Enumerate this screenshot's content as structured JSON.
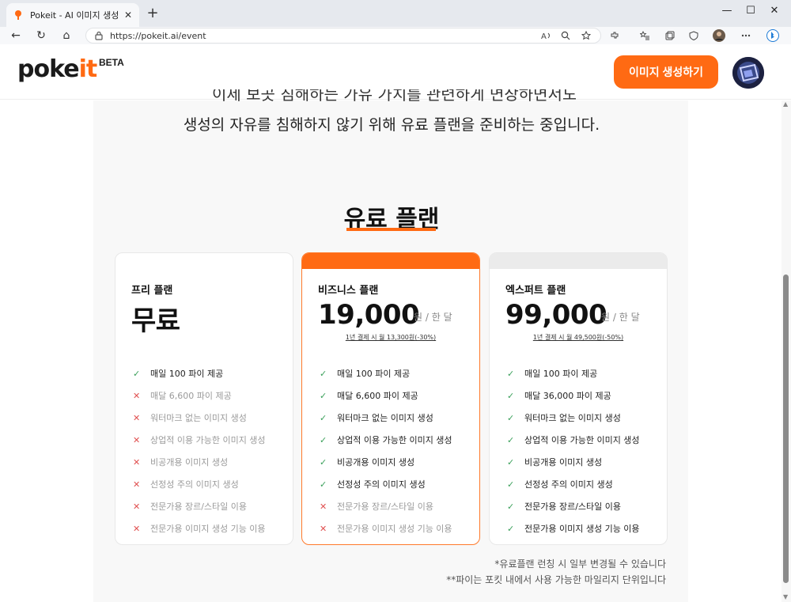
{
  "browser": {
    "tab_title": "Pokeit - AI 이미지 생성 레시피 공",
    "tab_close": "✕",
    "new_tab": "+",
    "url": "https://pokeit.ai/event",
    "window_controls": {
      "minimize": "—",
      "maximize": "☐",
      "close": "✕"
    },
    "nav": {
      "back": "←",
      "reload": "↻",
      "home": "⌂"
    }
  },
  "header": {
    "logo_main": "poke",
    "logo_accent": "it",
    "beta_label": "BETA",
    "cta_label": "이미지 생성하기"
  },
  "intro": {
    "line_cut": "이제 보곳 침해하는 가유 가치를 관련하게 면장하면서도",
    "line2": "생성의 자유를 침해하지 않기 위해 유료 플랜을 준비하는 중입니다."
  },
  "plans_title": "유료 플랜",
  "plans": [
    {
      "name": "프리 플랜",
      "price": "무료",
      "unit": "",
      "note": "",
      "features": [
        {
          "label": "매일 100 파이 제공",
          "included": true
        },
        {
          "label": "매달 6,600 파이 제공",
          "included": false
        },
        {
          "label": "워터마크 없는 이미지 생성",
          "included": false
        },
        {
          "label": "상업적 이용 가능한 이미지 생성",
          "included": false
        },
        {
          "label": "비공개용 이미지 생성",
          "included": false
        },
        {
          "label": "선정성 주의 이미지 생성",
          "included": false
        },
        {
          "label": "전문가용 장르/스타일 이용",
          "included": false
        },
        {
          "label": "전문가용 이미지 생성 기능 이용",
          "included": false
        }
      ]
    },
    {
      "name": "비즈니스 플랜",
      "price": "19,000",
      "unit": "원 / 한 달",
      "note": "1년 결제 시 월 13,300원(-30%)",
      "features": [
        {
          "label": "매일 100 파이 제공",
          "included": true
        },
        {
          "label": "매달 6,600 파이 제공",
          "included": true
        },
        {
          "label": "워터마크 없는 이미지 생성",
          "included": true
        },
        {
          "label": "상업적 이용 가능한 이미지 생성",
          "included": true
        },
        {
          "label": "비공개용 이미지 생성",
          "included": true
        },
        {
          "label": "선정성 주의 이미지 생성",
          "included": true
        },
        {
          "label": "전문가용 장르/스타일 이용",
          "included": false
        },
        {
          "label": "전문가용 이미지 생성 기능 이용",
          "included": false
        }
      ]
    },
    {
      "name": "엑스퍼트 플랜",
      "price": "99,000",
      "unit": "원 / 한 달",
      "note": "1년 결제 시 월 49,500원(-50%)",
      "features": [
        {
          "label": "매일 100 파이 제공",
          "included": true
        },
        {
          "label": "매달 36,000 파이 제공",
          "included": true
        },
        {
          "label": "워터마크 없는 이미지 생성",
          "included": true
        },
        {
          "label": "상업적 이용 가능한 이미지 생성",
          "included": true
        },
        {
          "label": "비공개용 이미지 생성",
          "included": true
        },
        {
          "label": "선정성 주의 이미지 생성",
          "included": true
        },
        {
          "label": "전문가용 장르/스타일 이용",
          "included": true
        },
        {
          "label": "전문가용 이미지 생성 기능 이용",
          "included": true
        }
      ]
    }
  ],
  "footnotes": [
    "*유료플랜 런칭 시 일부 변경될 수 있습니다",
    "**파이는 포킷 내에서 사용 가능한 마일리지 단위입니다"
  ],
  "marks": {
    "included": "✓",
    "excluded": "✕"
  },
  "colors": {
    "accent": "#ff6a13",
    "check": "#3aa05a",
    "cross": "#e05050"
  }
}
